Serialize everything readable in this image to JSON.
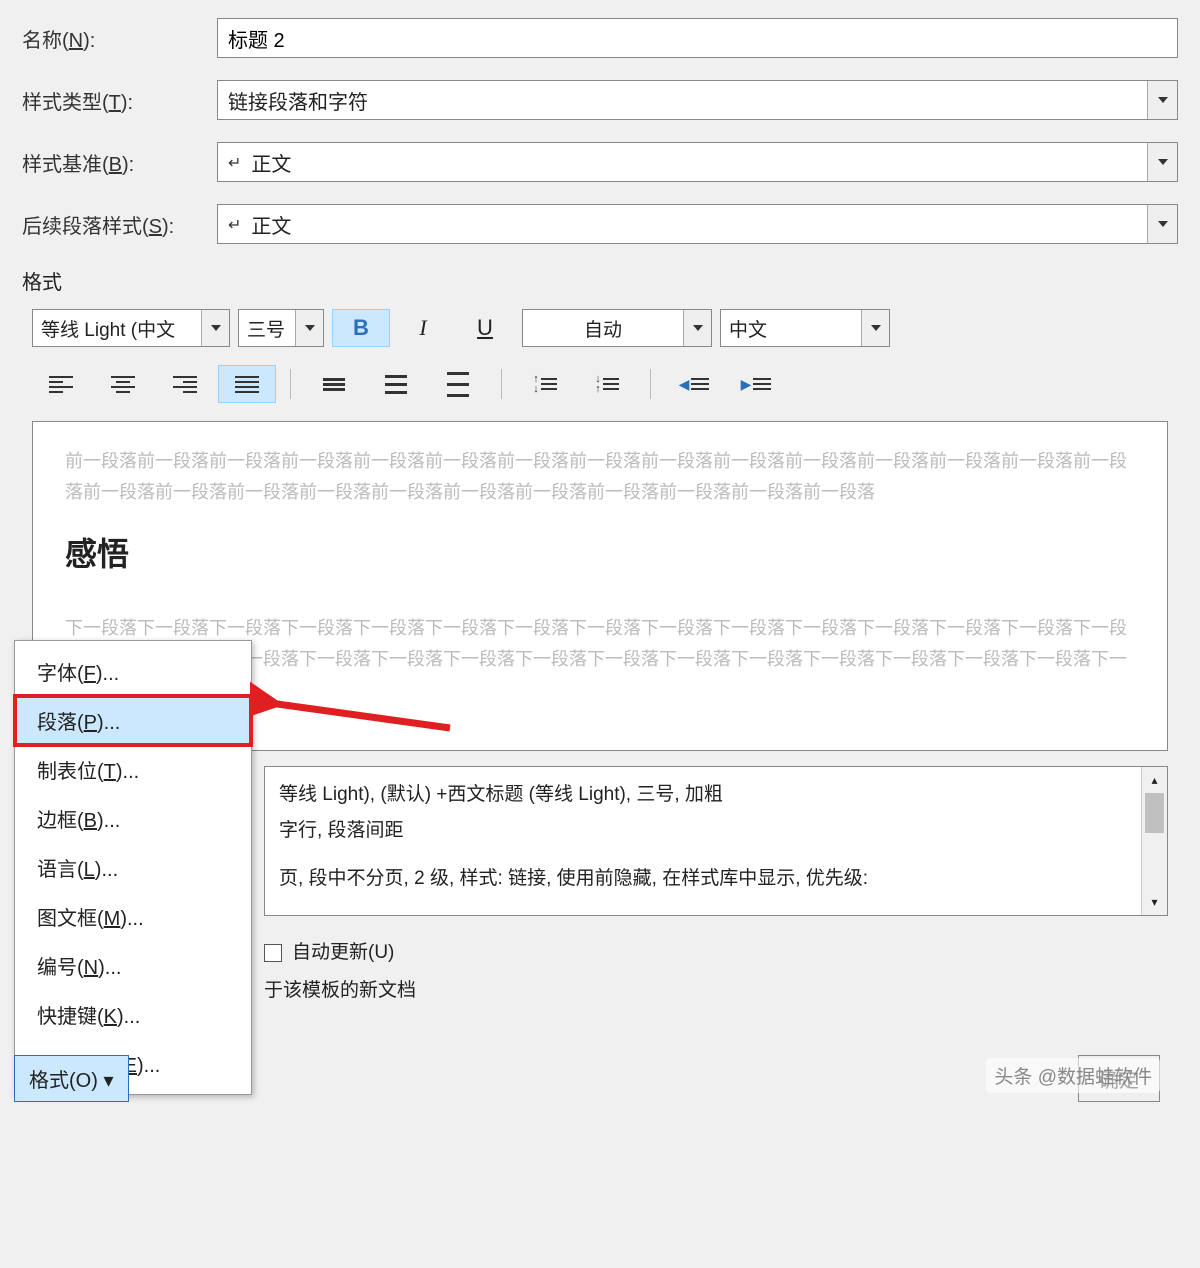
{
  "fields": {
    "name_label": "名称(N):",
    "name_value": "标题 2",
    "type_label": "样式类型(T):",
    "type_value": "链接段落和字符",
    "based_label": "样式基准(B):",
    "based_value": "正文",
    "follow_label": "后续段落样式(S):",
    "follow_value": "正文"
  },
  "format_section": "格式",
  "toolbar": {
    "font_name": "等线 Light (中文",
    "font_size": "三号",
    "bold": "B",
    "italic": "I",
    "underline": "U",
    "color": "自动",
    "lang": "中文"
  },
  "preview": {
    "prev_text": "前一段落前一段落前一段落前一段落前一段落前一段落前一段落前一段落前一段落前一段落前一段落前一段落前一段落前一段落前一段落前一段落前一段落前一段落前一段落前一段落前一段落前一段落前一段落前一段落前一段落前一段落",
    "heading": "感悟",
    "next_text": "下一段落下一段落下一段落下一段落下一段落下一段落下一段落下一段落下一段落下一段落下一段落下一段落下一段落下一段落下一段落下一段落下一段落下一段落下一段落下一段落下一段落下一段落下一段落下一段落下一段落下一段落下一段落下一段落下一段落下一"
  },
  "description": {
    "line1": "等线 Light), (默认) +西文标题 (等线 Light), 三号, 加粗",
    "line2": "字行, 段落间距",
    "line3": "页, 段中不分页, 2 级, 样式: 链接, 使用前隐藏, 在样式库中显示, 优先级:"
  },
  "checkboxes": {
    "auto_update": "自动更新(U)",
    "template": "于该模板的新文档"
  },
  "menu": {
    "font": "字体(F)...",
    "paragraph": "段落(P)...",
    "tabs": "制表位(T)...",
    "border": "边框(B)...",
    "language": "语言(L)...",
    "frame": "图文框(M)...",
    "numbering": "编号(N)...",
    "shortcut": "快捷键(K)...",
    "effects": "文字效果(E)..."
  },
  "buttons": {
    "format": "格式(O)",
    "ok": "确定"
  },
  "watermark": "头条 @数据蛙软件"
}
